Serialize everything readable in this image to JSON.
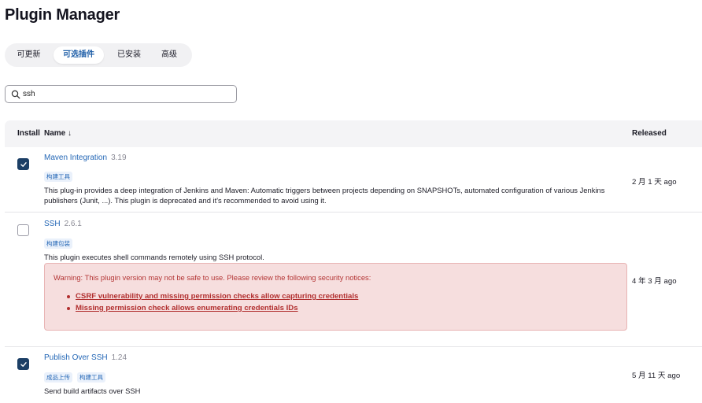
{
  "page": {
    "title": "Plugin Manager"
  },
  "tabs": [
    {
      "label": "可更新",
      "active": false
    },
    {
      "label": "可选插件",
      "active": true
    },
    {
      "label": "已安装",
      "active": false
    },
    {
      "label": "高级",
      "active": false
    }
  ],
  "search": {
    "value": "ssh",
    "icon": "search-icon"
  },
  "table": {
    "headers": {
      "install": "Install",
      "name": "Name ↓",
      "released": "Released"
    },
    "rows": [
      {
        "checked": true,
        "name": "Maven Integration",
        "version": "3.19",
        "tags": [
          "构建工具"
        ],
        "description": "This plug-in provides a deep integration of Jenkins and Maven: Automatic triggers between projects depending on SNAPSHOTs, automated configuration of various Jenkins publishers (Junit, ...). This plugin is deprecated and it's recommended to avoid using it.",
        "released": "2 月 1 天 ago"
      },
      {
        "checked": false,
        "name": "SSH",
        "version": "2.6.1",
        "tags": [
          "构建包装"
        ],
        "description": "This plugin executes shell commands remotely using SSH protocol.",
        "warning": {
          "text": "Warning: This plugin version may not be safe to use. Please review the following security notices:",
          "notices": [
            "CSRF vulnerability and missing permission checks allow capturing credentials",
            "Missing permission check allows enumerating credentials IDs"
          ]
        },
        "released": "4 年 3 月 ago"
      },
      {
        "checked": true,
        "name": "Publish Over SSH",
        "version": "1.24",
        "tags": [
          "成品上传",
          "构建工具"
        ],
        "description": "Send build artifacts over SSH",
        "released": "5 月 11 天 ago"
      }
    ]
  },
  "colors": {
    "link": "#2467b6",
    "checkbox": "#1c3f66",
    "warning_bg": "#f6dede",
    "warning_text": "#b43636"
  }
}
